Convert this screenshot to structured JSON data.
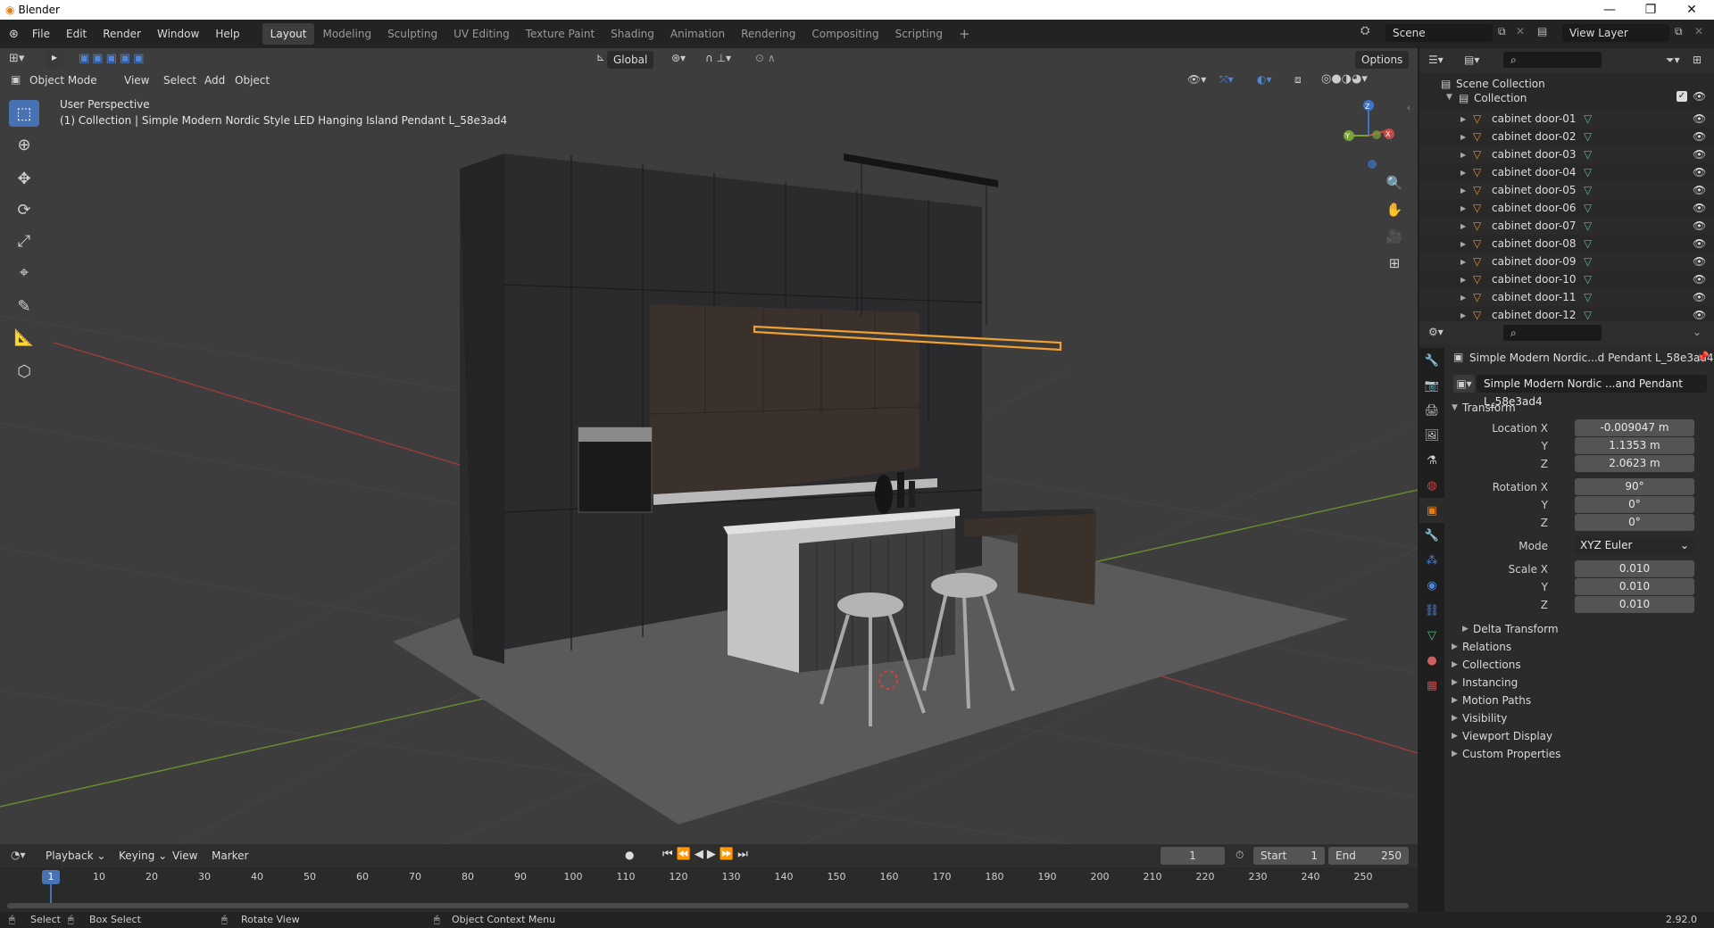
{
  "window": {
    "title": "Blender",
    "minimize": "—",
    "maximize": "❐",
    "close": "✕"
  },
  "menu": [
    "File",
    "Edit",
    "Render",
    "Window",
    "Help"
  ],
  "workspaces": [
    "Layout",
    "Modeling",
    "Sculpting",
    "UV Editing",
    "Texture Paint",
    "Shading",
    "Animation",
    "Rendering",
    "Compositing",
    "Scripting"
  ],
  "active_workspace": "Layout",
  "add_workspace": "+",
  "scene": {
    "label": "Scene",
    "view_layer": "View Layer"
  },
  "viewport_header": {
    "mode": "Object Mode",
    "menus": [
      "View",
      "Select",
      "Add",
      "Object"
    ],
    "orientation": "Global",
    "options": "Options"
  },
  "viewport": {
    "perspective": "User Perspective",
    "collection_info": "(1) Collection | Simple Modern Nordic Style LED Hanging Island Pendant L_58e3ad4"
  },
  "outliner": {
    "scene_collection": "Scene Collection",
    "collection": "Collection",
    "items": [
      "cabinet door-01",
      "cabinet door-02",
      "cabinet door-03",
      "cabinet door-04",
      "cabinet door-05",
      "cabinet door-06",
      "cabinet door-07",
      "cabinet door-08",
      "cabinet door-09",
      "cabinet door-10",
      "cabinet door-11",
      "cabinet door-12"
    ]
  },
  "properties": {
    "object_name_short": "Simple Modern Nordic...d Pendant L_58e3ad4",
    "object_name_field": "Simple Modern Nordic ...and Pendant L_58e3ad4",
    "transform_title": "Transform",
    "location": {
      "label_x": "Location X",
      "x": "-0.009047 m",
      "y": "1.1353 m",
      "z": "2.0623 m"
    },
    "rotation": {
      "label_x": "Rotation X",
      "x": "90°",
      "y": "0°",
      "z": "0°"
    },
    "mode_label": "Mode",
    "mode_value": "XYZ Euler",
    "scale": {
      "label_x": "Scale X",
      "x": "0.010",
      "y": "0.010",
      "z": "0.010"
    },
    "axis_y": "Y",
    "axis_z": "Z",
    "delta_transform": "Delta Transform",
    "panels": [
      "Relations",
      "Collections",
      "Instancing",
      "Motion Paths",
      "Visibility",
      "Viewport Display",
      "Custom Properties"
    ]
  },
  "timeline": {
    "menus": [
      "Playback",
      "Keying",
      "View",
      "Marker"
    ],
    "current_frame": "1",
    "start_label": "Start",
    "start": "1",
    "end_label": "End",
    "end": "250",
    "ticks": [
      "10",
      "20",
      "30",
      "40",
      "50",
      "60",
      "70",
      "80",
      "90",
      "100",
      "110",
      "120",
      "130",
      "140",
      "150",
      "160",
      "170",
      "180",
      "190",
      "200",
      "210",
      "220",
      "230",
      "240",
      "250"
    ],
    "frame_marker": "1"
  },
  "status": {
    "select": "Select",
    "box_select": "Box Select",
    "rotate_view": "Rotate View",
    "context_menu": "Object Context Menu",
    "version": "2.92.0"
  },
  "colors": {
    "accent": "#4772b3",
    "selection_outline": "#f0a030",
    "x_axis": "#c94a4a",
    "y_axis": "#7aa33a",
    "z_axis": "#3a74cc"
  }
}
